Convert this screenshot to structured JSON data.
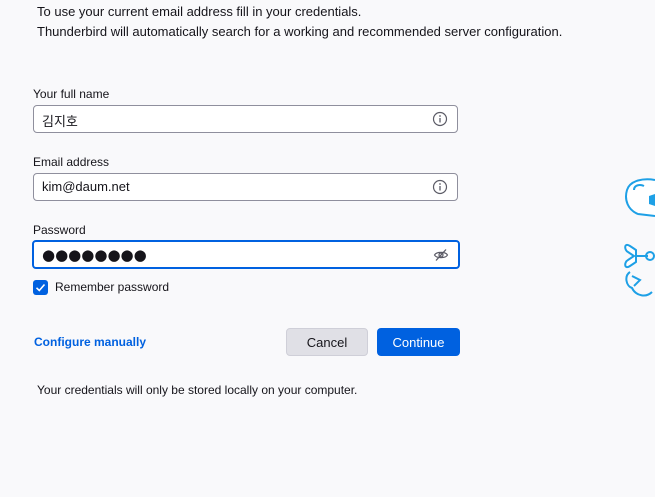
{
  "intro": {
    "line1": "To use your current email address fill in your credentials.",
    "line2": "Thunderbird will automatically search for a working and recommended server configuration."
  },
  "fields": {
    "full_name": {
      "label": "Your full name",
      "value": "김지호",
      "icon": "info-icon"
    },
    "email": {
      "label": "Email address",
      "value": "kim@daum.net",
      "icon": "info-icon"
    },
    "password": {
      "label": "Password",
      "masked_value": "●●●●●●●●",
      "icon": "eye-hidden-icon"
    }
  },
  "remember": {
    "label": "Remember password",
    "checked": true
  },
  "actions": {
    "configure_manually": "Configure manually",
    "cancel": "Cancel",
    "continue": "Continue"
  },
  "footnote": "Your credentials will only be stored locally on your computer.",
  "colors": {
    "accent": "#0061e0",
    "background": "#f9f9fb",
    "illustration": "#1ea0e6"
  }
}
